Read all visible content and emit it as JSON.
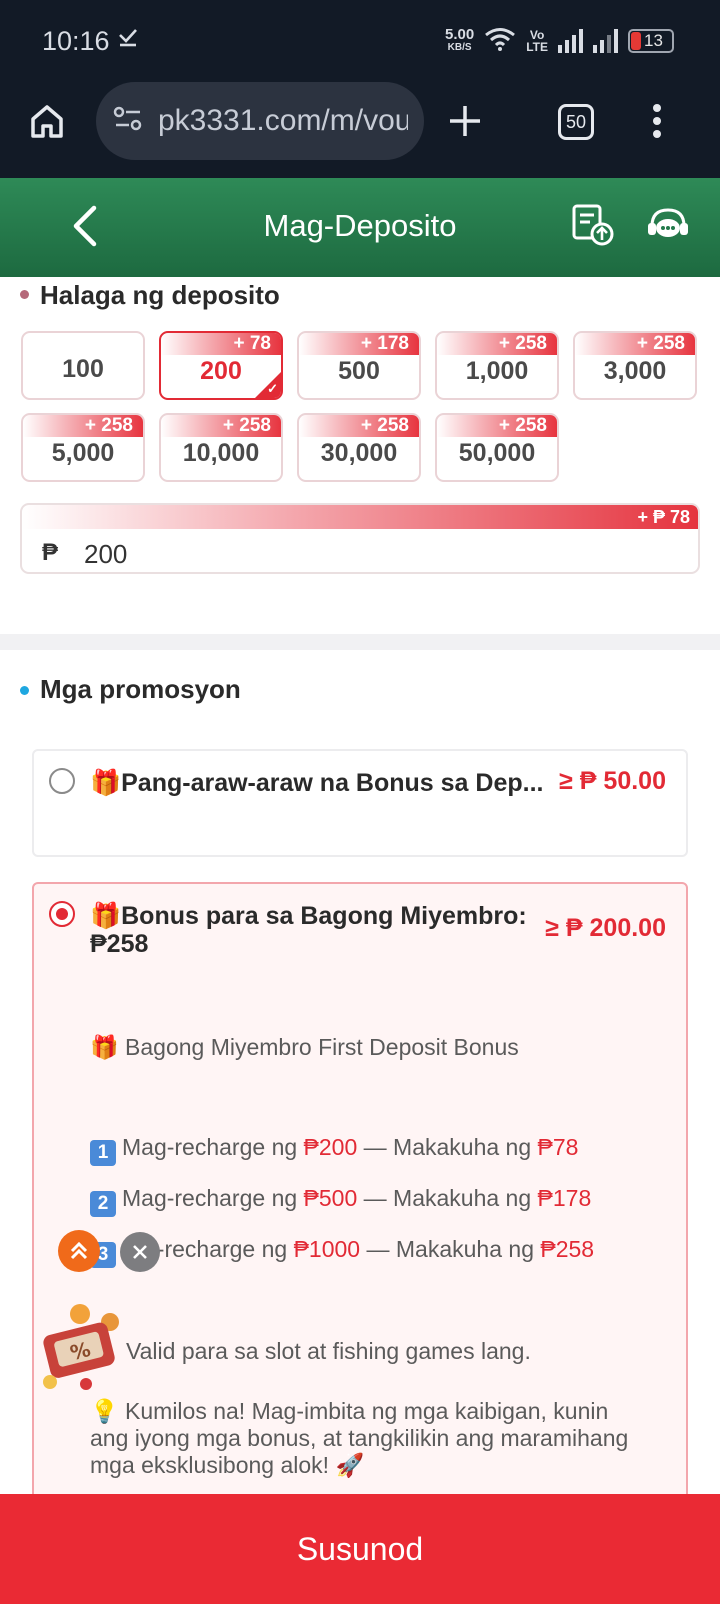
{
  "status_bar": {
    "time": "10:16",
    "speed_value": "5.00",
    "speed_unit": "KB/S",
    "lte_top": "Vo",
    "lte_bottom": "LTE",
    "battery": "13"
  },
  "browser": {
    "url": "pk3331.com/m/vou",
    "tab_count": "50"
  },
  "header": {
    "title": "Mag-Deposito"
  },
  "deposit": {
    "section_title": "Halaga ng deposito",
    "amounts": [
      {
        "value": "100",
        "bonus": ""
      },
      {
        "value": "200",
        "bonus": "+ 78"
      },
      {
        "value": "500",
        "bonus": "+ 178"
      },
      {
        "value": "1,000",
        "bonus": "+ 258"
      },
      {
        "value": "3,000",
        "bonus": "+ 258"
      },
      {
        "value": "5,000",
        "bonus": "+ 258"
      },
      {
        "value": "10,000",
        "bonus": "+ 258"
      },
      {
        "value": "30,000",
        "bonus": "+ 258"
      },
      {
        "value": "50,000",
        "bonus": "+ 258"
      }
    ],
    "selected_amount": "200",
    "currency_symbol": "₱",
    "input_value": "200",
    "input_bonus_tag": "+ ₱ 78"
  },
  "promotions": {
    "section_title": "Mga promosyon",
    "items": [
      {
        "title": "🎁Pang-araw-araw na Bonus sa Dep...",
        "min_amount": "≥ ₱ 50.00",
        "selected": false
      },
      {
        "title_line1": "🎁Bonus para sa Bagong Miyembro:",
        "title_line2": "₱258",
        "min_amount": "≥ ₱ 200.00",
        "selected": true,
        "description": {
          "heading": "🎁 Bagong Miyembro First Deposit Bonus",
          "tiers": [
            {
              "num": "1",
              "pre": "Mag-recharge ng ",
              "amount": "₱200",
              "mid": " — Makakuha ng ",
              "bonus": "₱78"
            },
            {
              "num": "2",
              "pre": "Mag-recharge ng ",
              "amount": "₱500",
              "mid": " — Makakuha ng ",
              "bonus": "₱178"
            },
            {
              "num": "3",
              "pre": "g-recharge ng ",
              "amount": "₱1000",
              "mid": " — Makakuha ng ",
              "bonus": "₱258"
            }
          ],
          "valid_note": "Valid para sa slot at fishing games lang.",
          "invite_line1": "💡 Kumilos na! Mag-imbita ng mga kaibigan, kunin",
          "invite_line2": "ang iyong mga bonus, at tangkilikin ang maramihang",
          "invite_line3": "mga eksklusibong alok! 🚀"
        }
      }
    ]
  },
  "footer": {
    "button_label": "Susunod"
  },
  "colors": {
    "accent_red": "#e22a35",
    "header_green": "#237a4b",
    "dark_bar": "#121a26"
  }
}
